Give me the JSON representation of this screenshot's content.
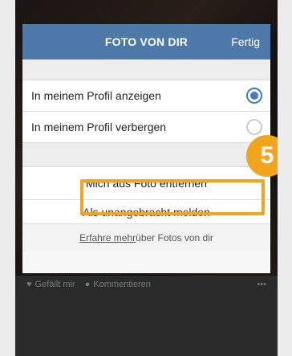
{
  "sheet": {
    "title": "FOTO VON DIR",
    "done_label": "Fertig"
  },
  "options": [
    {
      "label": "In meinem Profil anzeigen",
      "selected": true
    },
    {
      "label": "In meinem Profil verbergen",
      "selected": false
    }
  ],
  "actions": {
    "remove_label": "Mich aus Foto entfernen",
    "report_label": "Als unangebracht melden"
  },
  "footer": {
    "link_text": "Erfahre mehr",
    "rest_text": " über Fotos von dir"
  },
  "bottom_bar": {
    "like_label": "Gefällt mir",
    "comment_label": "Kommentieren",
    "more_label": "•••"
  },
  "annotation": {
    "step_number": "5",
    "accent_color": "#f3a41d"
  },
  "colors": {
    "header": "#4d79a8",
    "radio_active": "#3f7cc5"
  }
}
